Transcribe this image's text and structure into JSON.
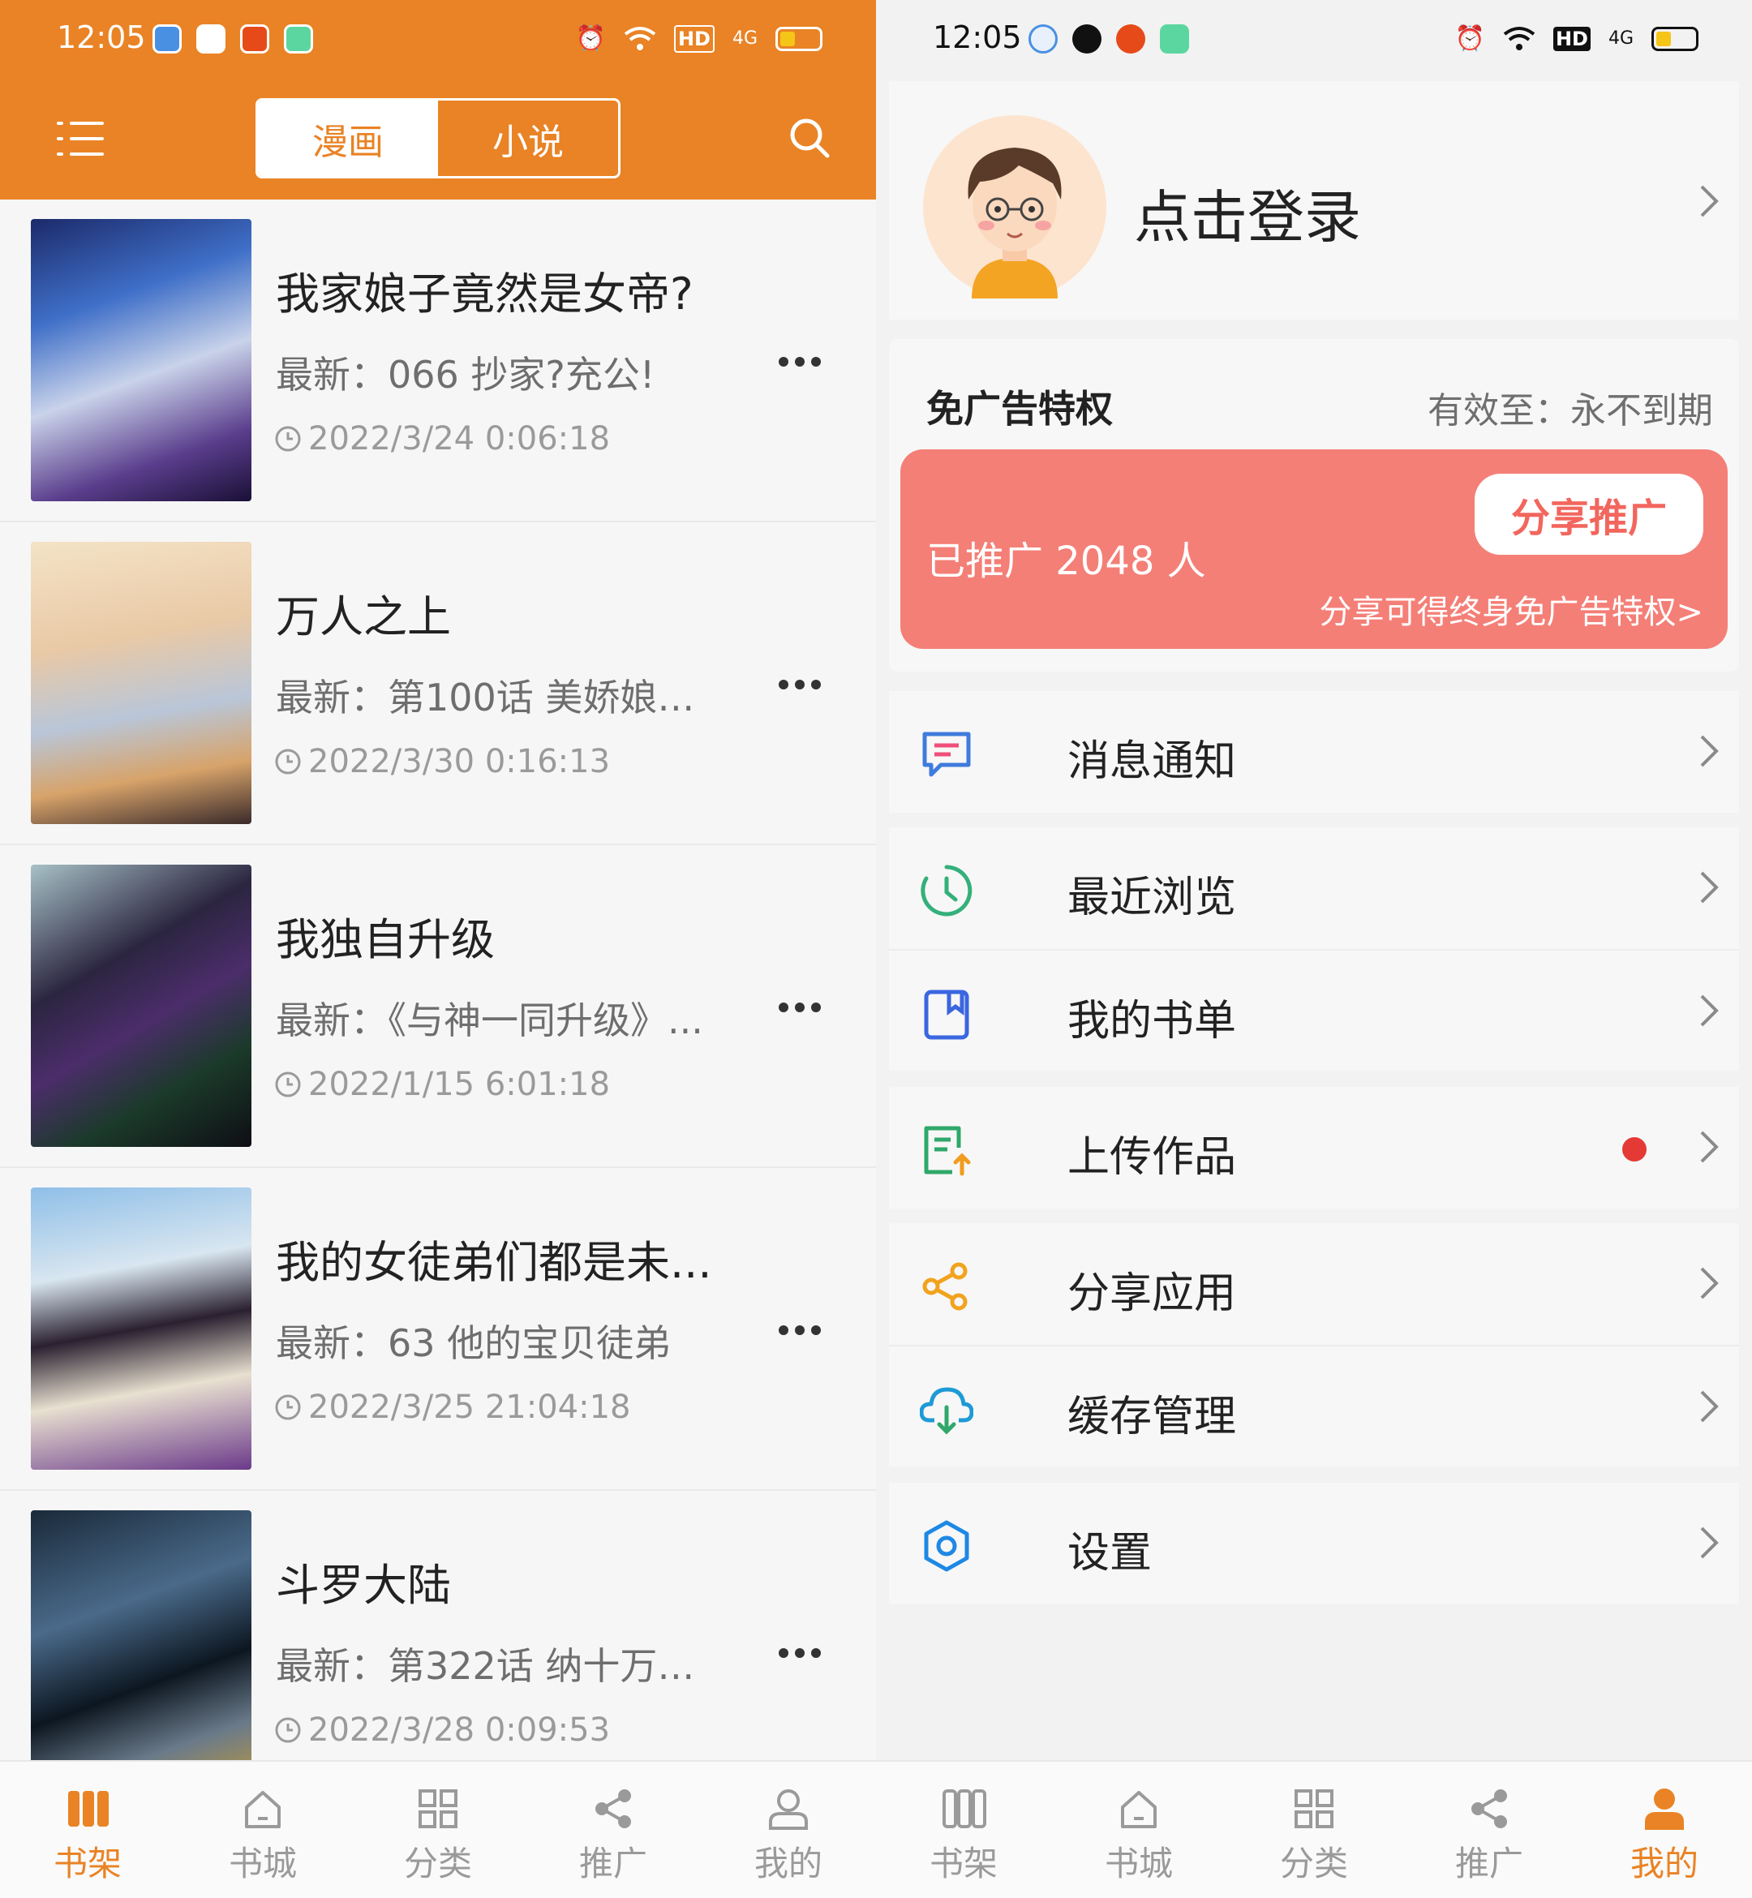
{
  "status_bar": {
    "time": "12:05",
    "network": "4G",
    "hd": "HD"
  },
  "comic_shelf": {
    "tabs": [
      {
        "label": "漫画",
        "active": true
      },
      {
        "label": "小说",
        "active": false
      }
    ],
    "books": [
      {
        "title": "我家娘子竟然是女帝?",
        "latest": "最新：066 抄家?充公!",
        "time": "2022/3/24 0:06:18"
      },
      {
        "title": "万人之上",
        "latest": "最新：第100话 美娇娘髅...",
        "time": "2022/3/30 0:16:13"
      },
      {
        "title": "我独自升级",
        "latest": "最新：《与神一同升级》...",
        "time": "2022/1/15 6:01:18"
      },
      {
        "title": "我的女徒弟们都是未...",
        "latest": "最新：63 他的宝贝徒弟",
        "time": "2022/3/25 21:04:18"
      },
      {
        "title": "斗罗大陆",
        "latest": "最新：第322话 纳十万年...",
        "time": "2022/3/28 0:09:53"
      }
    ]
  },
  "profile": {
    "login_label": "点击登录",
    "privilege": {
      "title": "免广告特权",
      "valid_until": "有效至：永不到期",
      "promoted": "已推广 2048 人",
      "share_button": "分享推广",
      "share_hint": "分享可得终身免广告特权>"
    },
    "menu": [
      {
        "label": "消息通知",
        "icon": "message-icon"
      },
      {
        "label": "最近浏览",
        "icon": "history-icon"
      },
      {
        "label": "我的书单",
        "icon": "booklist-icon"
      },
      {
        "label": "上传作品",
        "icon": "upload-icon",
        "badge": true
      },
      {
        "label": "分享应用",
        "icon": "share-icon"
      },
      {
        "label": "缓存管理",
        "icon": "cloud-download-icon"
      },
      {
        "label": "设置",
        "icon": "settings-icon"
      }
    ]
  },
  "bottom_nav": {
    "left": [
      {
        "label": "书架",
        "active": true
      },
      {
        "label": "书城"
      },
      {
        "label": "分类"
      },
      {
        "label": "推广"
      },
      {
        "label": "我的"
      }
    ],
    "right": [
      {
        "label": "书架"
      },
      {
        "label": "书城"
      },
      {
        "label": "分类"
      },
      {
        "label": "推广"
      },
      {
        "label": "我的",
        "active": true
      }
    ]
  },
  "colors": {
    "accent": "#e98325",
    "banner": "#f47f77",
    "badge": "#e53935"
  }
}
